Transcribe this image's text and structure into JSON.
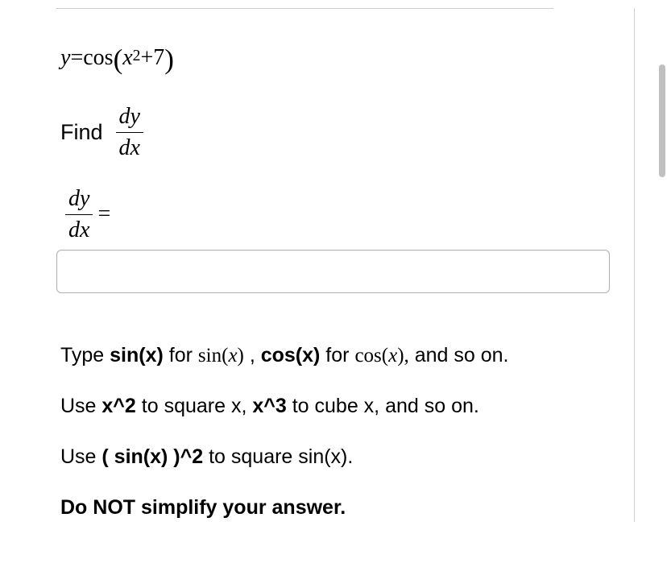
{
  "equation": {
    "lhs_var": "y",
    "equals": " = ",
    "func": "cos",
    "lparen": "(",
    "arg_base": "x",
    "arg_exp": "2",
    "plus": " + ",
    "const": "7",
    "rparen": ")"
  },
  "find": {
    "label": "Find",
    "frac_num1": "d",
    "frac_num2": "y",
    "frac_den1": "d",
    "frac_den2": "x"
  },
  "answer": {
    "frac_num1": "d",
    "frac_num2": "y",
    "frac_den1": "d",
    "frac_den2": "x",
    "equals": " = ",
    "value": "",
    "placeholder": ""
  },
  "instructions": {
    "line1_a": "Type ",
    "line1_b": "sin(x)",
    "line1_c": " for ",
    "line1_d": "sin",
    "line1_e": "(",
    "line1_f": "x",
    "line1_g": ")",
    "line1_h": " , ",
    "line1_i": "cos(x)",
    "line1_j": " for ",
    "line1_k": "cos",
    "line1_l": "(",
    "line1_m": "x",
    "line1_n": "),",
    "line1_o": " and so on.",
    "line2_a": "Use ",
    "line2_b": "x^2",
    "line2_c": " to square x, ",
    "line2_d": "x^3",
    "line2_e": " to cube x, and so on.",
    "line3_a": "Use ",
    "line3_b": "( sin(x) )^2",
    "line3_c": " to square sin(x).",
    "line4": "Do NOT simplify your answer."
  }
}
